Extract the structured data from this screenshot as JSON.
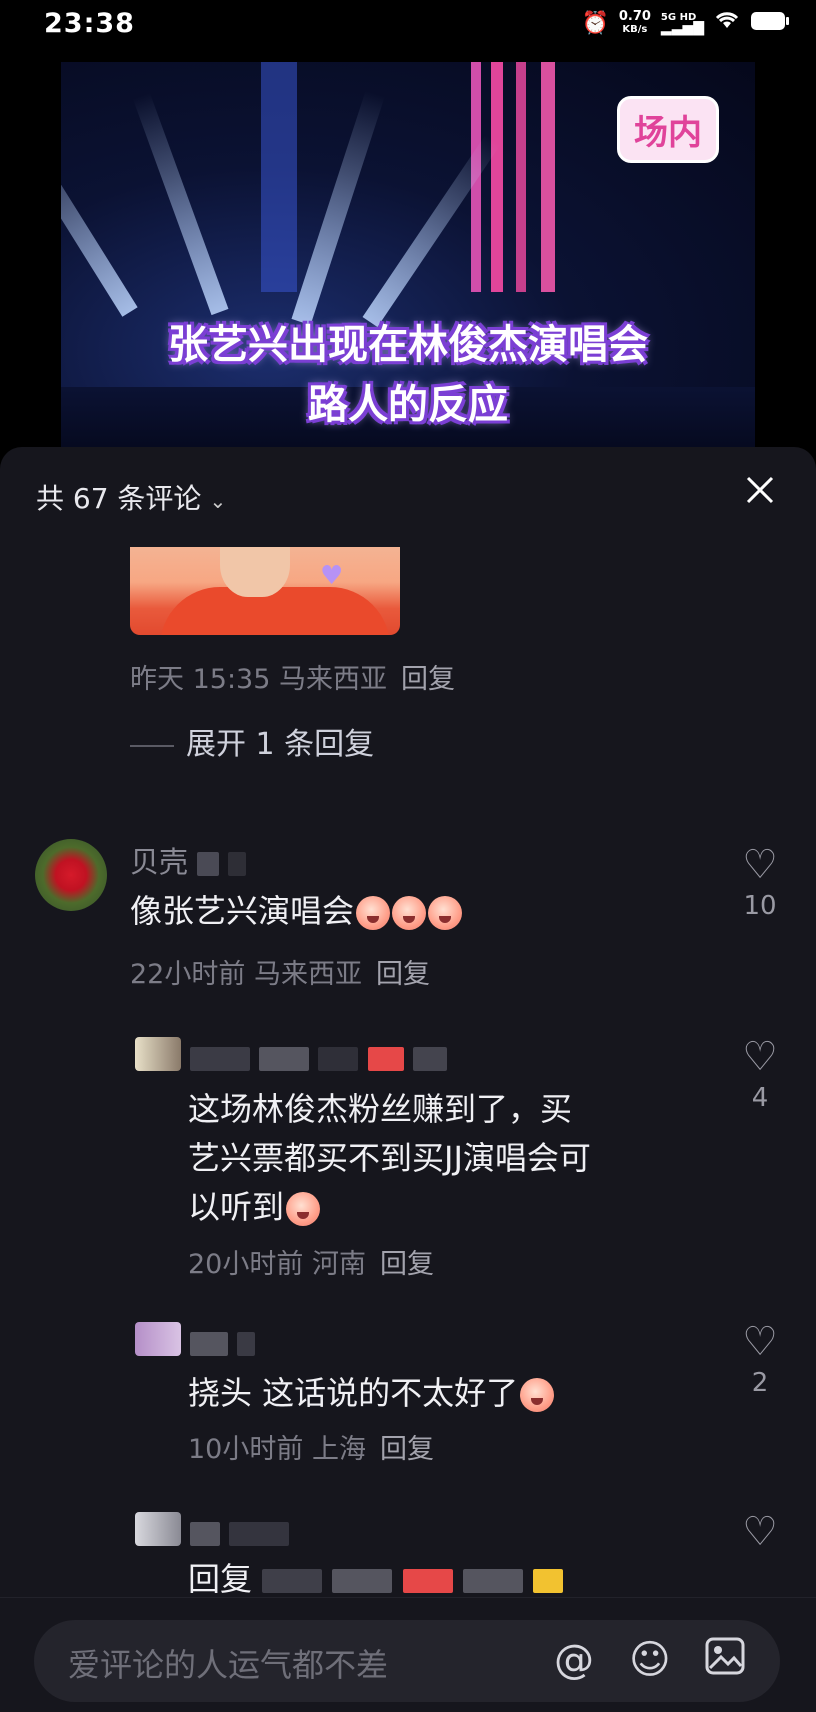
{
  "status": {
    "time": "23:38",
    "speed_value": "0.70",
    "speed_unit": "KB/s",
    "net_top": "5G HD"
  },
  "video": {
    "badge": "场内",
    "caption_line1": "张艺兴出现在林俊杰演唱会",
    "caption_line2": "路人的反应"
  },
  "comments_header": {
    "count_label": "共 67 条评论"
  },
  "prev_comment": {
    "meta": "昨天 15:35 马来西亚",
    "reply_label": "回复",
    "expand_label": "展开 1 条回复"
  },
  "comments": [
    {
      "username": "贝壳",
      "text": "像张艺兴演唱会",
      "meta": "22小时前 马来西亚",
      "reply_label": "回复",
      "likes": "10"
    },
    {
      "text": "这场林俊杰粉丝赚到了，买艺兴票都买不到买JJ演唱会可以听到",
      "text_lines": [
        "这场林俊杰粉丝赚到了，买",
        "艺兴票都买不到买JJ演唱会可",
        "以听到"
      ],
      "meta": "20小时前 河南",
      "reply_label": "回复",
      "likes": "4"
    },
    {
      "text": "挠头 这话说的不太好了",
      "meta": "10小时前 上海",
      "reply_label": "回复",
      "likes": "2"
    },
    {
      "text": "回复"
    }
  ],
  "input": {
    "placeholder": "爱评论的人运气都不差"
  }
}
